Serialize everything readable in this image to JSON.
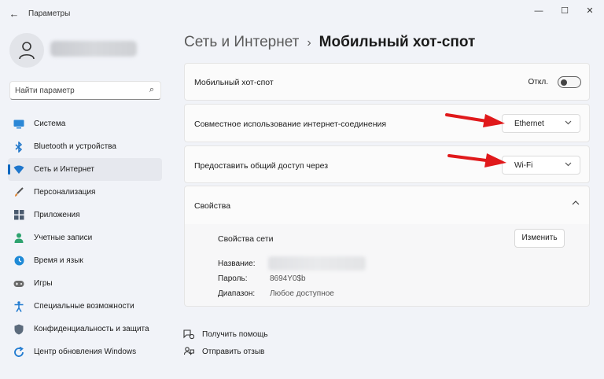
{
  "window": {
    "title": "Параметры",
    "back_glyph": "←",
    "minimize_glyph": "—",
    "maximize_glyph": "☐",
    "close_glyph": "✕"
  },
  "search": {
    "placeholder": "Найти параметр",
    "icon_glyph": "⌕"
  },
  "sidebar": {
    "items": [
      {
        "label": "Система",
        "icon": "system-icon",
        "color": "#0078d4"
      },
      {
        "label": "Bluetooth и устройства",
        "icon": "bluetooth-icon",
        "color": "#0078d4"
      },
      {
        "label": "Сеть и Интернет",
        "icon": "network-icon",
        "color": "#0078d4",
        "active": true
      },
      {
        "label": "Персонализация",
        "icon": "brush-icon",
        "color": "#e08a3c"
      },
      {
        "label": "Приложения",
        "icon": "apps-icon",
        "color": "#4a5a6e"
      },
      {
        "label": "Учетные записи",
        "icon": "accounts-icon",
        "color": "#2ea36f"
      },
      {
        "label": "Время и язык",
        "icon": "time-language-icon",
        "color": "#1f8ad6"
      },
      {
        "label": "Игры",
        "icon": "gaming-icon",
        "color": "#6b6b6b"
      },
      {
        "label": "Специальные возможности",
        "icon": "accessibility-icon",
        "color": "#1f7ad0"
      },
      {
        "label": "Конфиденциальность и защита",
        "icon": "privacy-shield-icon",
        "color": "#5c6b7c"
      },
      {
        "label": "Центр обновления Windows",
        "icon": "windows-update-icon",
        "color": "#1f7ad0"
      }
    ]
  },
  "breadcrumb": {
    "parent": "Сеть и Интернет",
    "separator": "›",
    "current": "Мобильный хот-спот"
  },
  "hotspot": {
    "label": "Мобильный хот-спот",
    "toggle_state": "Откл.",
    "enabled": false
  },
  "share_connection": {
    "label": "Совместное использование интернет-соединения",
    "selected": "Ethernet"
  },
  "share_via": {
    "label": "Предоставить общий доступ через",
    "selected": "Wi-Fi"
  },
  "properties": {
    "header": "Свойства",
    "network_properties_label": "Свойства сети",
    "edit_button": "Изменить",
    "name_label": "Название:",
    "password_label": "Пароль:",
    "password_value": "8694Y0$b",
    "band_label": "Диапазон:",
    "band_value": "Любое доступное"
  },
  "help": {
    "get_help": "Получить помощь",
    "feedback": "Отправить отзыв"
  },
  "colors": {
    "accent": "#0067c0",
    "annotation_arrow": "#e0191b"
  }
}
